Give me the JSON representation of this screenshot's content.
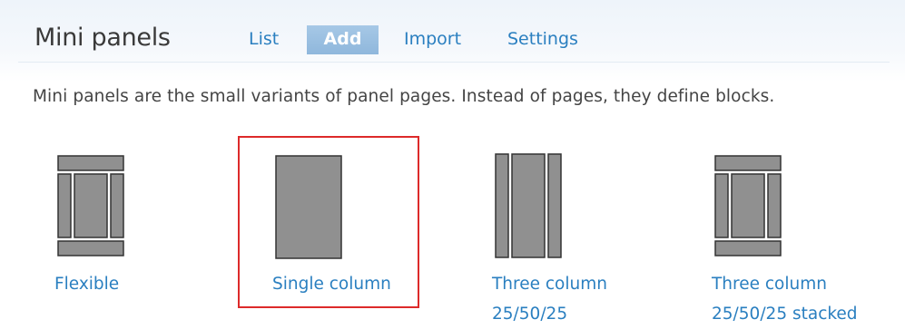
{
  "header": {
    "title": "Mini panels",
    "tabs": [
      {
        "label": "List",
        "active": false
      },
      {
        "label": "Add",
        "active": true
      },
      {
        "label": "Import",
        "active": false
      },
      {
        "label": "Settings",
        "active": false
      }
    ]
  },
  "description": "Mini panels are the small variants of panel pages. Instead of pages, they define blocks.",
  "layouts": [
    {
      "line1": "Flexible",
      "line2": "",
      "icon": "flexible-layout-icon"
    },
    {
      "line1": "Single column",
      "line2": "",
      "icon": "single-column-layout-icon",
      "selected": true
    },
    {
      "line1": "Three column",
      "line2": "25/50/25",
      "icon": "three-column-layout-icon"
    },
    {
      "line1": "Three column",
      "line2": "25/50/25 stacked",
      "icon": "three-column-stacked-layout-icon"
    }
  ],
  "colors": {
    "link": "#2a7fc0",
    "active_tab_bg": "#9bbfe2",
    "layout_icon_fill": "#909090",
    "layout_icon_stroke": "#333333",
    "selection_border": "#dd2a2a"
  }
}
